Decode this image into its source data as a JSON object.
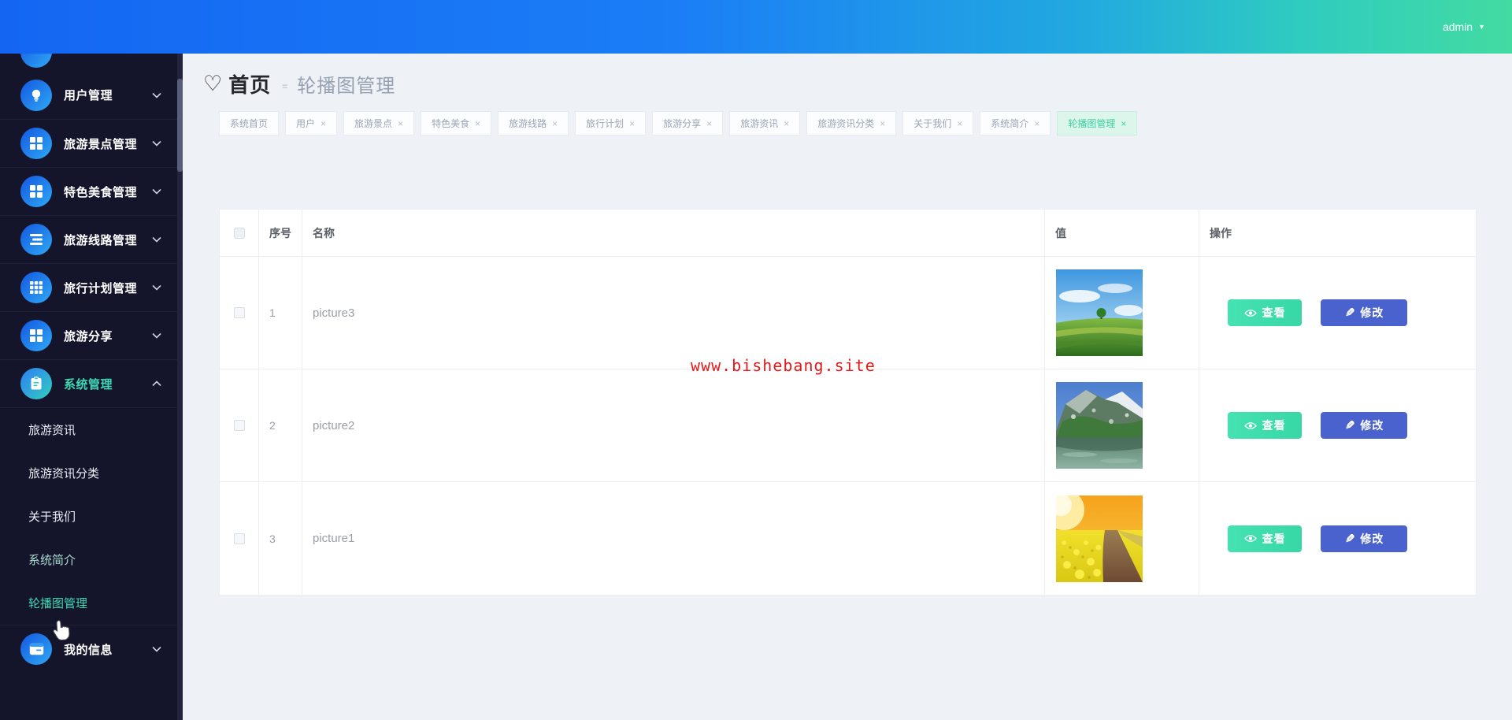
{
  "header": {
    "user": "admin",
    "caret": "▼"
  },
  "sidebar": {
    "items": [
      {
        "label": "用户管理",
        "icon": "lightbulb-icon"
      },
      {
        "label": "旅游景点管理",
        "icon": "grid-icon"
      },
      {
        "label": "特色美食管理",
        "icon": "grid-icon"
      },
      {
        "label": "旅游线路管理",
        "icon": "list-icon"
      },
      {
        "label": "旅行计划管理",
        "icon": "grid-3x3-icon"
      },
      {
        "label": "旅游分享",
        "icon": "grid-icon"
      },
      {
        "label": "系统管理",
        "icon": "clipboard-icon",
        "active": true
      },
      {
        "label": "我的信息",
        "icon": "window-icon"
      }
    ],
    "submenu": [
      {
        "label": "旅游资讯"
      },
      {
        "label": "旅游资讯分类"
      },
      {
        "label": "关于我们"
      },
      {
        "label": "系统简介",
        "state": "visited"
      },
      {
        "label": "轮播图管理",
        "state": "active"
      }
    ]
  },
  "breadcrumb": {
    "heart": "♡",
    "home": "首页",
    "separator": "=",
    "current": "轮播图管理"
  },
  "tags": {
    "close_symbol": "×",
    "items": [
      {
        "label": "系统首页",
        "closable": false
      },
      {
        "label": "用户",
        "closable": true
      },
      {
        "label": "旅游景点",
        "closable": true
      },
      {
        "label": "特色美食",
        "closable": true
      },
      {
        "label": "旅游线路",
        "closable": true
      },
      {
        "label": "旅行计划",
        "closable": true
      },
      {
        "label": "旅游分享",
        "closable": true
      },
      {
        "label": "旅游资讯",
        "closable": true
      },
      {
        "label": "旅游资讯分类",
        "closable": true
      },
      {
        "label": "关于我们",
        "closable": true
      },
      {
        "label": "系统简介",
        "closable": true
      },
      {
        "label": "轮播图管理",
        "closable": true,
        "active": true
      }
    ]
  },
  "table": {
    "columns": {
      "index": "序号",
      "name": "名称",
      "value": "值",
      "actions": "操作"
    },
    "rows": [
      {
        "index": "1",
        "name": "picture3",
        "image": "meadow-tree-photo"
      },
      {
        "index": "2",
        "name": "picture2",
        "image": "mountain-lake-photo"
      },
      {
        "index": "3",
        "name": "picture1",
        "image": "rapeseed-field-photo"
      }
    ],
    "actions": {
      "view": "查看",
      "edit": "修改",
      "edit_icon": "✎"
    }
  },
  "watermark": "www.bishebang.site",
  "colors": {
    "accent_teal": "#3fd8b4",
    "accent_blue": "#1b7ef6",
    "button_view": "#3edbab",
    "button_edit": "#4a62cd",
    "watermark_red": "#e01b1b"
  }
}
